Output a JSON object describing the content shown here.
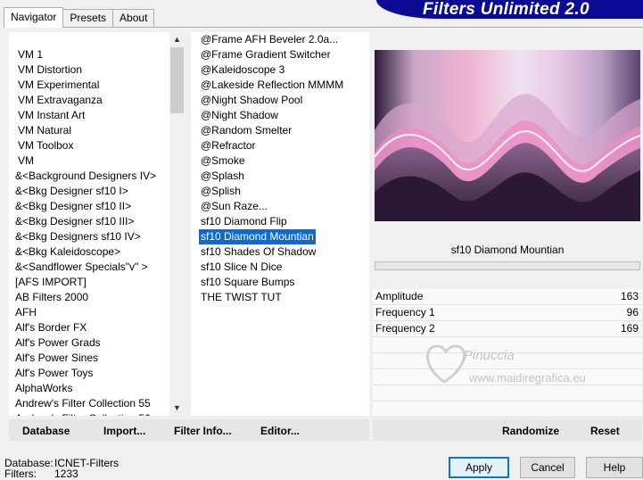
{
  "tabs": [
    {
      "label": "Navigator",
      "active": true
    },
    {
      "label": "Presets",
      "active": false
    },
    {
      "label": "About",
      "active": false
    }
  ],
  "app_title": "Filters Unlimited 2.0",
  "categories": [
    "VM 1",
    "VM Distortion",
    "VM Experimental",
    "VM Extravaganza",
    "VM Instant Art",
    "VM Natural",
    "VM Toolbox",
    "VM",
    "&<Background Designers IV>",
    "&<Bkg Designer sf10 I>",
    "&<Bkg Designer sf10 II>",
    "&<Bkg Designer sf10 III>",
    "&<Bkg Designers sf10 IV>",
    "&<Bkg Kaleidoscope>",
    "&<Sandflower Specials\"v\" >",
    "[AFS IMPORT]",
    "AB Filters 2000",
    "AFH",
    "Alf's Border FX",
    "Alf's Power Grads",
    "Alf's Power Sines",
    "Alf's Power Toys",
    "AlphaWorks",
    "Andrew's Filter Collection 55",
    "Andrew's Filter Collection 56"
  ],
  "filters": [
    "@Frame AFH Beveler 2.0a...",
    "@Frame Gradient Switcher",
    "@Kaleidoscope 3",
    "@Lakeside Reflection MMMM",
    "@Night Shadow Pool",
    "@Night Shadow",
    "@Random Smelter",
    "@Refractor",
    "@Smoke",
    "@Splash",
    "@Splish",
    "@Sun Raze...",
    "sf10 Diamond Flip",
    "sf10 Diamond Mountian",
    "sf10 Shades Of Shadow",
    "sf10 Slice N Dice",
    "sf10 Square Bumps",
    "THE TWIST TUT"
  ],
  "selected_filter_index": 13,
  "preview": {
    "filter_name": "sf10 Diamond Mountian"
  },
  "parameters": [
    {
      "name": "Amplitude",
      "value": "163"
    },
    {
      "name": "Frequency 1",
      "value": "96"
    },
    {
      "name": "Frequency 2",
      "value": "169"
    }
  ],
  "watermark": {
    "line1": "Pinuccia",
    "line2": "www.maidiregrafica.eu"
  },
  "toolbar_left": {
    "database": "Database",
    "import": "Import...",
    "filter_info": "Filter Info...",
    "editor": "Editor..."
  },
  "toolbar_right": {
    "randomize": "Randomize",
    "reset": "Reset"
  },
  "status": {
    "database_label": "Database:",
    "database_value": "ICNET-Filters",
    "filters_label": "Filters:",
    "filters_value": "1233"
  },
  "buttons": {
    "apply": "Apply",
    "cancel": "Cancel",
    "help": "Help"
  },
  "colors": {
    "selection": "#0a6ad8",
    "banner": "#0b0b95"
  }
}
